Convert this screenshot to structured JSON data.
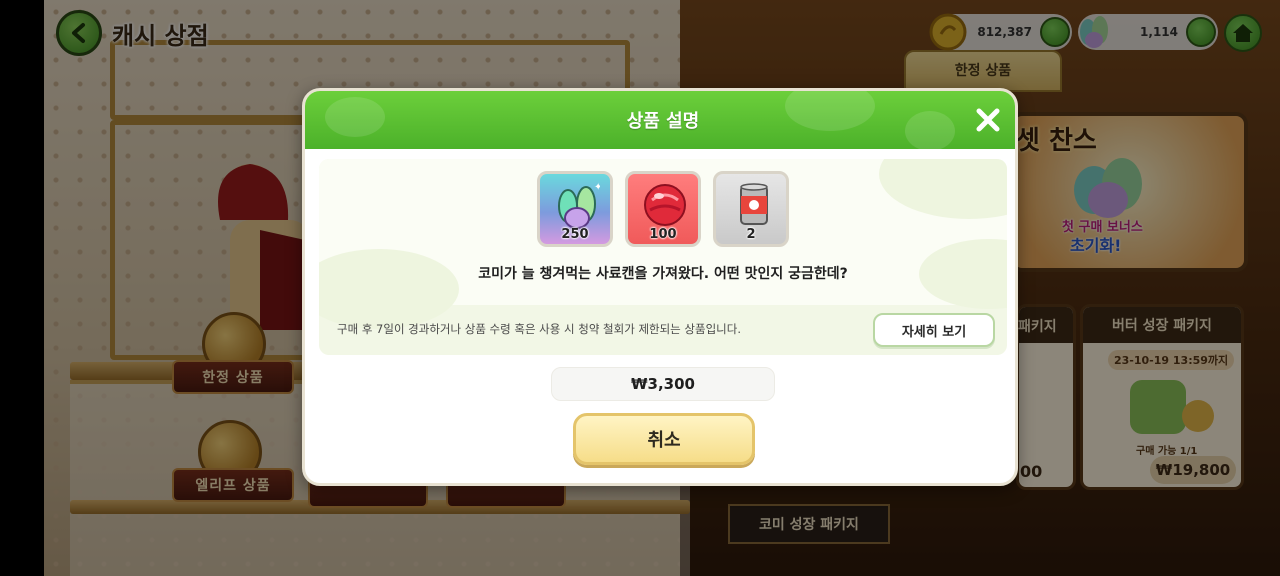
{
  "header": {
    "title": "캐시 상점"
  },
  "currency": {
    "coins": "812,387",
    "crystals": "1,114"
  },
  "shop": {
    "limited_tab": "한정 상품",
    "chance_title": "셋 찬스",
    "chance_bonus": "첫 구매 보너스",
    "chance_reset": "초기화!",
    "butter_package_title": "버터 성장 패키지",
    "butter_package_deadline": "23-10-19 13:59까지",
    "butter_package_limit": "구매 가능 1/1",
    "butter_package_price": "₩19,800",
    "partial_package_title": "패키지",
    "partial_package_price": "00",
    "comi_package": "코미 성장 패키지",
    "left_plaque_limited": "한정 상품",
    "left_plaque_elif": "엘리프 상품"
  },
  "modal": {
    "title": "상품 설명",
    "items": [
      {
        "icon": "crystal-icon",
        "qty": "250"
      },
      {
        "icon": "red-gem-icon",
        "qty": "100"
      },
      {
        "icon": "pet-food-can-icon",
        "qty": "2"
      }
    ],
    "description": "코미가 늘 챙겨먹는 사료캔을 가져왔다. 어떤 맛인지 궁금한데?",
    "notice": "구매 후 7일이 경과하거나 상품 수령 혹은 사용 시 청약 철회가 제한되는 상품입니다.",
    "details_label": "자세히 보기",
    "price": "₩3,300",
    "cancel_label": "취소"
  },
  "colors": {
    "modal_header": "#5bbf32",
    "cancel_button": "#f6dd89",
    "accent_green": "#4cb12a"
  }
}
